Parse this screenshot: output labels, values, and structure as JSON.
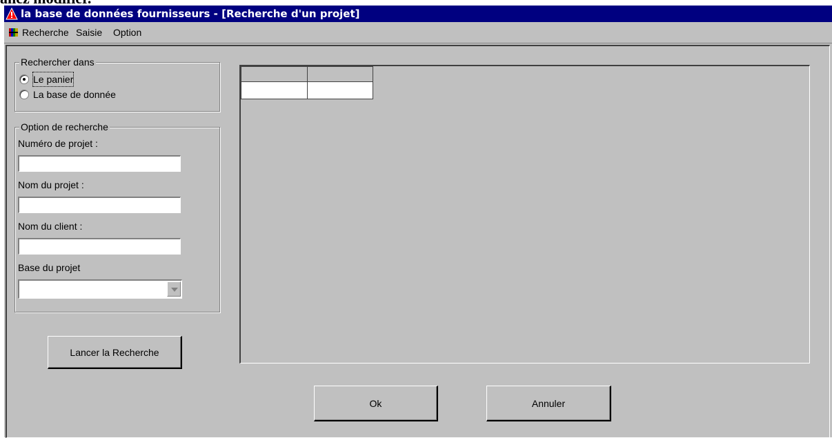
{
  "document_fragment": "ancz modifier.",
  "window": {
    "title": "la base de données fournisseurs - [Recherche d'un projet]",
    "icon": "app-warning-triangle-icon"
  },
  "menu": {
    "icon": "books-icon",
    "items": [
      "Recherche",
      "Saisie",
      "Option"
    ]
  },
  "search_in": {
    "title": "Rechercher dans",
    "options": [
      {
        "label": "Le panier",
        "selected": true
      },
      {
        "label": "La base de donnée",
        "selected": false
      }
    ]
  },
  "search_options": {
    "title": "Option de recherche",
    "project_number": {
      "label": "Numéro de projet :",
      "value": ""
    },
    "project_name": {
      "label": "Nom du projet :",
      "value": ""
    },
    "client_name": {
      "label": "Nom du client :",
      "value": ""
    },
    "project_base": {
      "label": "Base du projet",
      "value": ""
    }
  },
  "buttons": {
    "search": "Lancer la Recherche",
    "ok": "Ok",
    "cancel": "Annuler"
  },
  "results_grid": {
    "columns": [
      "",
      ""
    ],
    "rows": [
      [
        "",
        ""
      ]
    ]
  }
}
